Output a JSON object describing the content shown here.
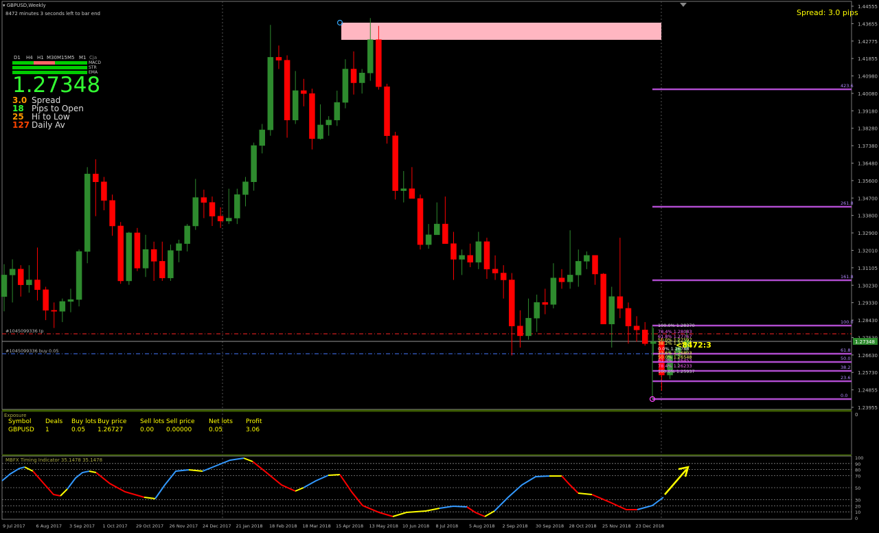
{
  "window": {
    "title": "GBPUSD,Weekly",
    "countdown": "8472 minutes 3 seconds left to bar end",
    "spread_label": "Spread: 3.0 pips"
  },
  "dashboard": {
    "timeframes": [
      "D1",
      "H4",
      "H1",
      "M30",
      "M15",
      "M5",
      "M1"
    ],
    "extra_label": "Cja",
    "rows": [
      {
        "label": "MACD",
        "cells": [
          "#00cc00",
          "#00cc00",
          "#ff6666",
          "#ff6666",
          "#00cc00",
          "#00cc00",
          "#00cc00"
        ]
      },
      {
        "label": "STR",
        "cells": [
          "#00cc00",
          "#00cc00",
          "#00cc00",
          "#00cc00",
          "#00cc00",
          "#00cc00",
          "#00cc00"
        ]
      },
      {
        "label": "EMA",
        "cells": [
          "#00cc00",
          "#00cc00",
          "#00cc00",
          "#00cc00",
          "#00cc00",
          "#00cc00",
          "#00cc00"
        ]
      }
    ],
    "price": "1.27348",
    "stats": [
      {
        "value": "3.0",
        "label": "Spread",
        "color": "#ff9900"
      },
      {
        "value": "18",
        "label": "Pips to Open",
        "color": "#33ff33"
      },
      {
        "value": "25",
        "label": "Hi to Low",
        "color": "#ff9900"
      },
      {
        "value": "127",
        "label": "Daily Av",
        "color": "#ff4400"
      }
    ]
  },
  "price_axis": {
    "labels": [
      "1.44555",
      "1.43655",
      "1.42775",
      "1.41855",
      "1.40980",
      "1.40080",
      "1.39180",
      "1.38280",
      "1.37380",
      "1.36480",
      "1.35600",
      "1.34700",
      "1.33800",
      "1.32900",
      "1.32010",
      "1.31105",
      "1.30230",
      "1.29330",
      "1.28430",
      "1.27530",
      "1.26630",
      "1.25730",
      "1.24855",
      "1.23955"
    ],
    "current_price": "1.27348"
  },
  "orders": {
    "tp_label": "#1045099336 tp",
    "buy_label": "#1045099336 buy 0.05"
  },
  "fib_ext": {
    "labels": [
      "423.6",
      "261.8",
      "161.8",
      "100.0",
      "61.8",
      "50.0",
      "38.2",
      "23.6",
      "0.0"
    ]
  },
  "fib_small": {
    "labels": [
      "100.0%  1.28370",
      "78.4%  1.28083",
      "61.8%  1.27767",
      "50.0%  1.27597",
      "38.2%  1.27427",
      "0.0%  1.26788",
      "23.6%  1.26803",
      "50.0%  1.26548",
      "61.8%  1.26453",
      "78.4%  1.26233",
      "100.0%  1.25937"
    ],
    "timer": "<8472:3"
  },
  "date_axis": {
    "labels": [
      "9 Jul 2017",
      "6 Aug 2017",
      "3 Sep 2017",
      "1 Oct 2017",
      "29 Oct 2017",
      "26 Nov 2017",
      "24 Dec 2017",
      "21 Jan 2018",
      "18 Feb 2018",
      "18 Mar 2018",
      "15 Apr 2018",
      "13 May 2018",
      "10 Jun 2018",
      "8 Jul 2018",
      "5 Aug 2018",
      "2 Sep 2018",
      "30 Sep 2018",
      "28 Oct 2018",
      "25 Nov 2018",
      "23 Dec 2018"
    ]
  },
  "exposure": {
    "title": "Exposure",
    "headers": [
      "Symbol",
      "Deals",
      "Buy lots",
      "Buy price",
      "Sell lots",
      "Sell price",
      "Net lots",
      "Profit"
    ],
    "row": [
      "GBPUSD",
      "1",
      "0.05",
      "1.26727",
      "0.00",
      "0.00000",
      "0.05",
      "3.06"
    ],
    "axis_labels": [
      "0"
    ]
  },
  "indicator": {
    "title": "MBFX Timing Indicator 35.1478 35.1478",
    "levels": [
      "100",
      "90",
      "80",
      "70",
      "50",
      "30",
      "20",
      "10",
      "0"
    ]
  },
  "colors": {
    "bull": "#2e8b2e",
    "bear": "#ff0000",
    "fib": "#b04ccf",
    "zone": "#ffb6c1",
    "grid": "#666666"
  },
  "chart_data": {
    "type": "candlestick",
    "note_series": "weekly GBPUSD",
    "candles": [
      {
        "o": 1.296,
        "h": 1.3125,
        "l": 1.2885,
        "c": 1.307
      },
      {
        "o": 1.307,
        "h": 1.315,
        "l": 1.293,
        "c": 1.31
      },
      {
        "o": 1.31,
        "h": 1.312,
        "l": 1.296,
        "c": 1.302
      },
      {
        "o": 1.302,
        "h": 1.312,
        "l": 1.298,
        "c": 1.3045
      },
      {
        "o": 1.3045,
        "h": 1.321,
        "l": 1.294,
        "c": 1.2995
      },
      {
        "o": 1.2995,
        "h": 1.301,
        "l": 1.284,
        "c": 1.289
      },
      {
        "o": 1.289,
        "h": 1.293,
        "l": 1.28,
        "c": 1.2885
      },
      {
        "o": 1.2885,
        "h": 1.295,
        "l": 1.283,
        "c": 1.2935
      },
      {
        "o": 1.2935,
        "h": 1.3,
        "l": 1.288,
        "c": 1.2945
      },
      {
        "o": 1.2945,
        "h": 1.32,
        "l": 1.291,
        "c": 1.319
      },
      {
        "o": 1.319,
        "h": 1.362,
        "l": 1.313,
        "c": 1.3585
      },
      {
        "o": 1.3585,
        "h": 1.366,
        "l": 1.337,
        "c": 1.3545
      },
      {
        "o": 1.3545,
        "h": 1.357,
        "l": 1.34,
        "c": 1.345
      },
      {
        "o": 1.345,
        "h": 1.348,
        "l": 1.327,
        "c": 1.332
      },
      {
        "o": 1.332,
        "h": 1.334,
        "l": 1.3025,
        "c": 1.304
      },
      {
        "o": 1.304,
        "h": 1.329,
        "l": 1.302,
        "c": 1.3285
      },
      {
        "o": 1.3285,
        "h": 1.331,
        "l": 1.309,
        "c": 1.3105
      },
      {
        "o": 1.3105,
        "h": 1.3275,
        "l": 1.306,
        "c": 1.32
      },
      {
        "o": 1.32,
        "h": 1.324,
        "l": 1.304,
        "c": 1.314
      },
      {
        "o": 1.314,
        "h": 1.324,
        "l": 1.304,
        "c": 1.3055
      },
      {
        "o": 1.3055,
        "h": 1.3225,
        "l": 1.304,
        "c": 1.3195
      },
      {
        "o": 1.3195,
        "h": 1.325,
        "l": 1.3135,
        "c": 1.323
      },
      {
        "o": 1.323,
        "h": 1.333,
        "l": 1.319,
        "c": 1.332
      },
      {
        "o": 1.332,
        "h": 1.356,
        "l": 1.33,
        "c": 1.3465
      },
      {
        "o": 1.3465,
        "h": 1.3505,
        "l": 1.336,
        "c": 1.344
      },
      {
        "o": 1.344,
        "h": 1.347,
        "l": 1.332,
        "c": 1.337
      },
      {
        "o": 1.337,
        "h": 1.3415,
        "l": 1.331,
        "c": 1.3345
      },
      {
        "o": 1.3345,
        "h": 1.351,
        "l": 1.333,
        "c": 1.336
      },
      {
        "o": 1.336,
        "h": 1.351,
        "l": 1.333,
        "c": 1.348
      },
      {
        "o": 1.348,
        "h": 1.357,
        "l": 1.342,
        "c": 1.3545
      },
      {
        "o": 1.3545,
        "h": 1.3745,
        "l": 1.35,
        "c": 1.373
      },
      {
        "o": 1.373,
        "h": 1.384,
        "l": 1.369,
        "c": 1.381
      },
      {
        "o": 1.381,
        "h": 1.4345,
        "l": 1.378,
        "c": 1.418
      },
      {
        "o": 1.418,
        "h": 1.424,
        "l": 1.412,
        "c": 1.4165
      },
      {
        "o": 1.4165,
        "h": 1.419,
        "l": 1.377,
        "c": 1.386
      },
      {
        "o": 1.386,
        "h": 1.411,
        "l": 1.384,
        "c": 1.401
      },
      {
        "o": 1.401,
        "h": 1.407,
        "l": 1.393,
        "c": 1.3995
      },
      {
        "o": 1.3995,
        "h": 1.402,
        "l": 1.371,
        "c": 1.3765
      },
      {
        "o": 1.3765,
        "h": 1.394,
        "l": 1.376,
        "c": 1.3835
      },
      {
        "o": 1.3835,
        "h": 1.388,
        "l": 1.378,
        "c": 1.386
      },
      {
        "o": 1.386,
        "h": 1.401,
        "l": 1.383,
        "c": 1.395
      },
      {
        "o": 1.395,
        "h": 1.417,
        "l": 1.392,
        "c": 1.412
      },
      {
        "o": 1.412,
        "h": 1.421,
        "l": 1.399,
        "c": 1.405
      },
      {
        "o": 1.405,
        "h": 1.412,
        "l": 1.3995,
        "c": 1.41
      },
      {
        "o": 1.41,
        "h": 1.438,
        "l": 1.406,
        "c": 1.427
      },
      {
        "o": 1.427,
        "h": 1.434,
        "l": 1.4015,
        "c": 1.403
      },
      {
        "o": 1.403,
        "h": 1.4045,
        "l": 1.374,
        "c": 1.378
      },
      {
        "o": 1.378,
        "h": 1.38,
        "l": 1.3455,
        "c": 1.35
      },
      {
        "o": 1.35,
        "h": 1.36,
        "l": 1.344,
        "c": 1.351
      },
      {
        "o": 1.351,
        "h": 1.362,
        "l": 1.346,
        "c": 1.346
      },
      {
        "o": 1.346,
        "h": 1.348,
        "l": 1.32,
        "c": 1.3225
      },
      {
        "o": 1.3225,
        "h": 1.333,
        "l": 1.3204,
        "c": 1.3275
      },
      {
        "o": 1.3275,
        "h": 1.344,
        "l": 1.328,
        "c": 1.333
      },
      {
        "o": 1.333,
        "h": 1.347,
        "l": 1.333,
        "c": 1.323
      },
      {
        "o": 1.323,
        "h": 1.329,
        "l": 1.3045,
        "c": 1.315
      },
      {
        "o": 1.315,
        "h": 1.32,
        "l": 1.307,
        "c": 1.317
      },
      {
        "o": 1.317,
        "h": 1.323,
        "l": 1.311,
        "c": 1.3135
      },
      {
        "o": 1.3135,
        "h": 1.329,
        "l": 1.31,
        "c": 1.324
      },
      {
        "o": 1.324,
        "h": 1.326,
        "l": 1.305,
        "c": 1.31
      },
      {
        "o": 1.31,
        "h": 1.317,
        "l": 1.3045,
        "c": 1.308
      },
      {
        "o": 1.308,
        "h": 1.312,
        "l": 1.295,
        "c": 1.3045
      },
      {
        "o": 1.3045,
        "h": 1.308,
        "l": 1.266,
        "c": 1.281
      },
      {
        "o": 1.281,
        "h": 1.289,
        "l": 1.27,
        "c": 1.276
      },
      {
        "o": 1.276,
        "h": 1.295,
        "l": 1.274,
        "c": 1.285
      },
      {
        "o": 1.285,
        "h": 1.297,
        "l": 1.278,
        "c": 1.293
      },
      {
        "o": 1.293,
        "h": 1.3,
        "l": 1.287,
        "c": 1.292
      },
      {
        "o": 1.292,
        "h": 1.313,
        "l": 1.29,
        "c": 1.3055
      },
      {
        "o": 1.3055,
        "h": 1.31,
        "l": 1.3,
        "c": 1.3035
      },
      {
        "o": 1.3035,
        "h": 1.3298,
        "l": 1.3,
        "c": 1.307
      },
      {
        "o": 1.307,
        "h": 1.32,
        "l": 1.301,
        "c": 1.314
      },
      {
        "o": 1.314,
        "h": 1.319,
        "l": 1.31,
        "c": 1.317
      },
      {
        "o": 1.317,
        "h": 1.317,
        "l": 1.302,
        "c": 1.3075
      },
      {
        "o": 1.3075,
        "h": 1.308,
        "l": 1.288,
        "c": 1.282
      },
      {
        "o": 1.282,
        "h": 1.301,
        "l": 1.27,
        "c": 1.296
      },
      {
        "o": 1.296,
        "h": 1.326,
        "l": 1.285,
        "c": 1.29
      },
      {
        "o": 1.29,
        "h": 1.293,
        "l": 1.272,
        "c": 1.281
      },
      {
        "o": 1.281,
        "h": 1.286,
        "l": 1.273,
        "c": 1.279
      },
      {
        "o": 1.279,
        "h": 1.283,
        "l": 1.271,
        "c": 1.272
      },
      {
        "o": 1.272,
        "h": 1.28,
        "l": 1.266,
        "c": 1.273
      },
      {
        "o": 1.273,
        "h": 1.275,
        "l": 1.248,
        "c": 1.256
      },
      {
        "o": 1.256,
        "h": 1.269,
        "l": 1.254,
        "c": 1.266
      },
      {
        "o": 1.266,
        "h": 1.275,
        "l": 1.26,
        "c": 1.27
      },
      {
        "o": 1.27,
        "h": 1.279,
        "l": 1.266,
        "c": 1.2735
      }
    ],
    "price_range": [
      1.2385,
      1.4465
    ]
  }
}
